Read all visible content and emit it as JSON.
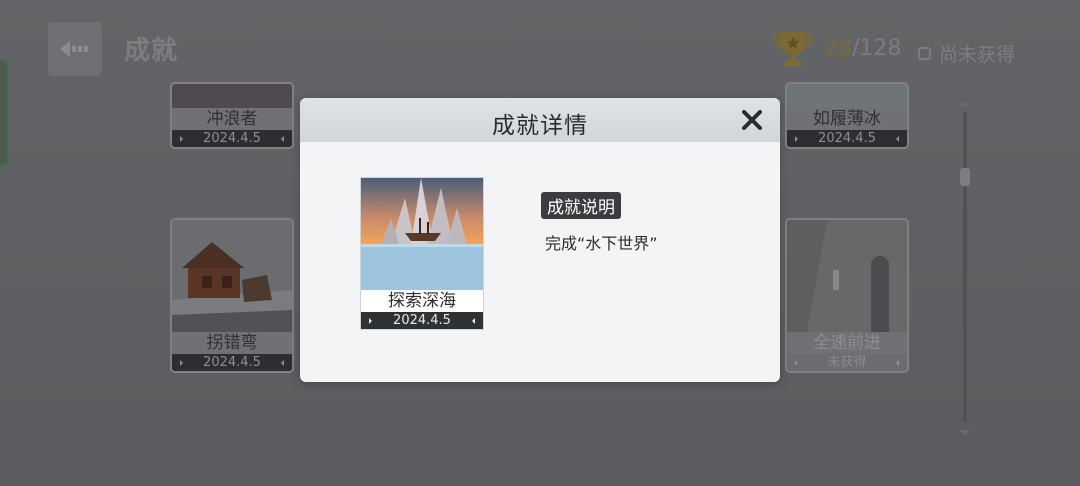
{
  "header": {
    "title": "成就",
    "progress_got": "28",
    "progress_total": "/128",
    "filter_label": "尚未获得"
  },
  "cards": [
    {
      "name": "冲浪者",
      "date": "2024.4.5"
    },
    {
      "name": "如履薄冰",
      "date": "2024.4.5"
    },
    {
      "name": "拐错弯",
      "date": "2024.4.5"
    },
    {
      "name": "全速前进",
      "date": "未获得"
    }
  ],
  "modal": {
    "title": "成就详情",
    "achievement_name": "探索深海",
    "achievement_date": "2024.4.5",
    "desc_label": "成就说明",
    "desc_text": "完成“水下世界”"
  },
  "colors": {
    "accent_gold": "#c9a43a",
    "modal_bg": "#f3f4f5",
    "overlay": "#5e6063"
  }
}
